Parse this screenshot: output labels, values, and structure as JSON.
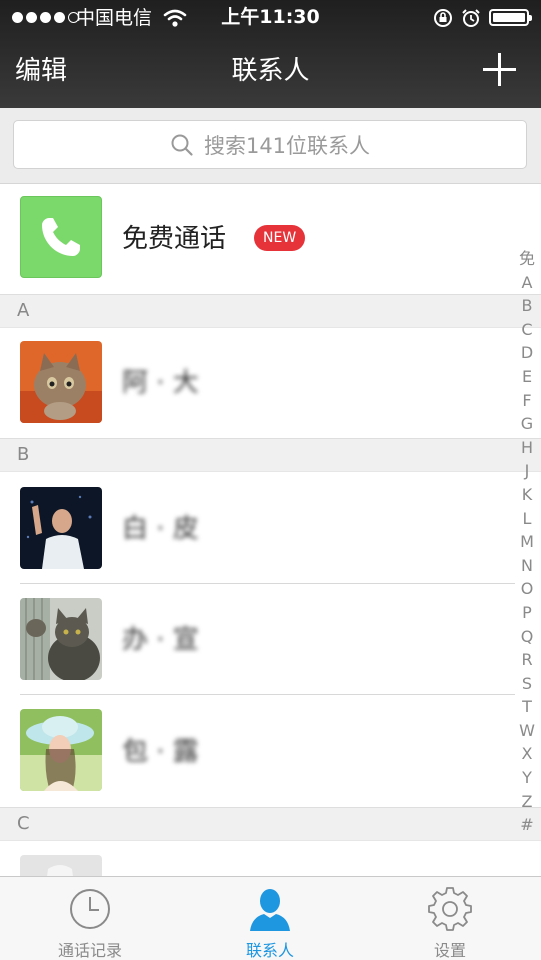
{
  "status_bar": {
    "carrier": "中国电信",
    "time": "上午11:30"
  },
  "nav": {
    "left_label": "编辑",
    "title": "联系人",
    "add_icon": "plus-icon"
  },
  "search": {
    "placeholder": "搜索141位联系人"
  },
  "free_call": {
    "label": "免费通话",
    "badge": "NEW",
    "icon": "phone-icon",
    "tile_color": "#7bd86a"
  },
  "sections": [
    {
      "letter": "A",
      "contacts": [
        {
          "name": "阿 · 大"
        }
      ]
    },
    {
      "letter": "B",
      "contacts": [
        {
          "name": "白 · 皮"
        },
        {
          "name": "办 · 宣"
        },
        {
          "name": "包 · 露"
        }
      ]
    },
    {
      "letter": "C",
      "contacts": []
    }
  ],
  "index_letters": [
    "免",
    "A",
    "B",
    "C",
    "D",
    "E",
    "F",
    "G",
    "H",
    "J",
    "K",
    "L",
    "M",
    "N",
    "O",
    "P",
    "Q",
    "R",
    "S",
    "T",
    "W",
    "X",
    "Y",
    "Z",
    "#"
  ],
  "tabs": [
    {
      "label": "通话记录",
      "icon": "clock-icon",
      "active": false
    },
    {
      "label": "联系人",
      "icon": "person-icon",
      "active": true
    },
    {
      "label": "设置",
      "icon": "gear-icon",
      "active": false
    }
  ],
  "colors": {
    "accent": "#1e96e0",
    "badge": "#e6333a",
    "header": "#2a2a2a"
  }
}
